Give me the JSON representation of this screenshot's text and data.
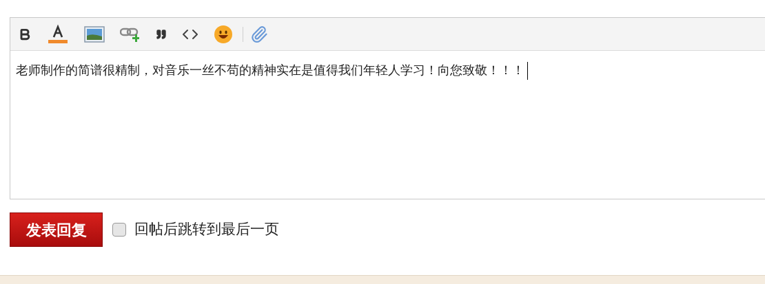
{
  "editor": {
    "text": "老师制作的简谱很精制，对音乐一丝不苟的精神实在是值得我们年轻人学习！向您致敬！！！",
    "focused": true
  },
  "submit_button": {
    "label": "发表回复"
  },
  "jump_option": {
    "label": "回帖后跳转到最后一页",
    "checked": false
  }
}
